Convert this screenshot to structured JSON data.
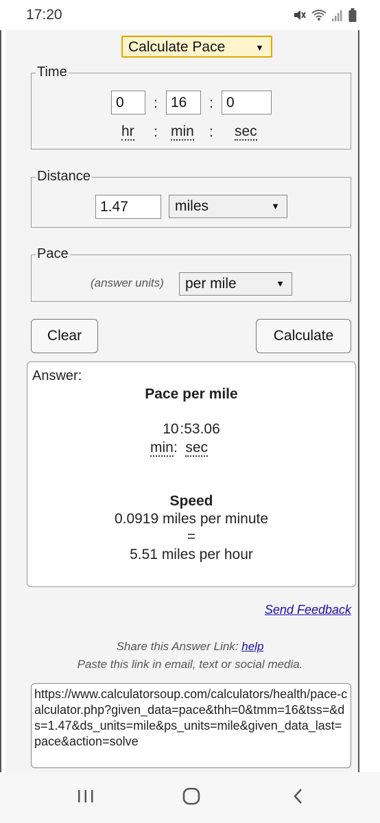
{
  "status": {
    "time": "17:20",
    "icons": [
      "mute-icon",
      "wifi-icon",
      "signal-icon",
      "battery-icon"
    ]
  },
  "calculator": {
    "mode_select": "Calculate Pace",
    "time": {
      "legend": "Time",
      "hours": "0",
      "minutes": "16",
      "seconds": "0",
      "hr_label": "hr",
      "min_label": "min",
      "sec_label": "sec",
      "colon": ":"
    },
    "distance": {
      "legend": "Distance",
      "value": "1.47",
      "unit": "miles"
    },
    "pace": {
      "legend": "Pace",
      "hint": "(answer units)",
      "unit": "per mile"
    },
    "clear_label": "Clear",
    "calculate_label": "Calculate"
  },
  "answer": {
    "label": "Answer:",
    "pace_title": "Pace per mile",
    "pace_min": "10",
    "pace_sec": ":53.06",
    "min_label": "min",
    "sec_label": "sec",
    "speed_title": "Speed",
    "speed_mpm": "0.0919 miles per minute",
    "equals": "=",
    "speed_mph": "5.51 miles per hour"
  },
  "feedback_link": "Send Feedback",
  "share": {
    "text": "Share this Answer Link:",
    "help": "help",
    "paste_text": "Paste this link in email, text or social media.",
    "url": "https://www.calculatorsoup.com/calculators/health/pace-calculator.php?given_data=pace&thh=0&tmm=16&tss=&ds=1.47&ds_units=mile&ps_units=mile&given_data_last=pace&action=solve"
  },
  "colors": {
    "accent_select_bg": "#fff4cc",
    "accent_select_border": "#e0a800",
    "link": "#1a0dab"
  }
}
